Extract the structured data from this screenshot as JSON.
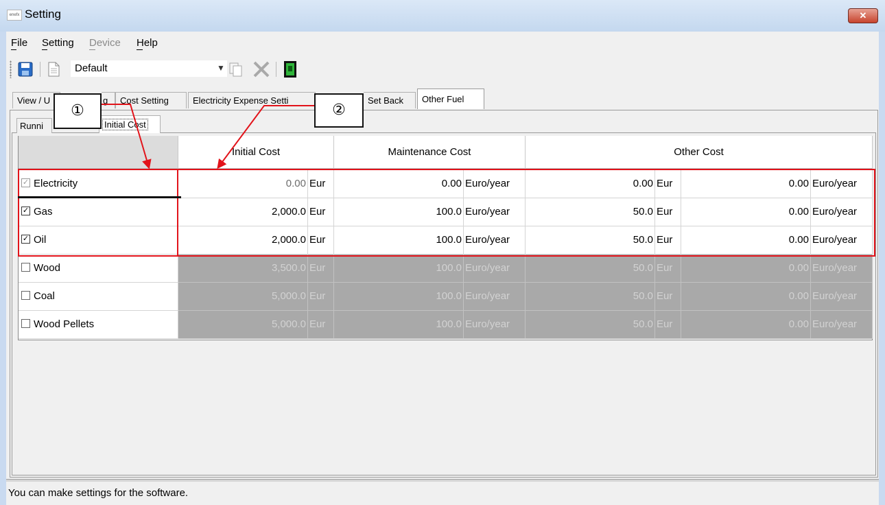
{
  "window": {
    "title": "Setting",
    "app_icon_text": "enefx",
    "close_label": "✕"
  },
  "menu": {
    "items": [
      "File",
      "Setting",
      "Device",
      "Help"
    ]
  },
  "toolbar": {
    "profile_value": "Default"
  },
  "main_tabs": [
    "View / U",
    "g",
    "Cost Setting",
    "Electricity Expense Setti",
    "Set Back",
    "Other Fuel"
  ],
  "sub_tabs": [
    "Runni",
    "Initial Cost"
  ],
  "grid": {
    "headers": [
      "Initial Cost",
      "Maintenance Cost",
      "Other Cost"
    ],
    "rows": [
      {
        "name": "Electricity",
        "checked": true,
        "enabled_checkbox": false,
        "row_disabled": false,
        "v1": "0.00",
        "u1": "Eur",
        "v2": "0.00",
        "u2": "Euro/year",
        "v3": "0.00",
        "u3": "Eur",
        "v4": "0.00",
        "u4": "Euro/year"
      },
      {
        "name": "Gas",
        "checked": true,
        "enabled_checkbox": true,
        "row_disabled": false,
        "v1": "2,000.0",
        "u1": "Eur",
        "v2": "100.0",
        "u2": "Euro/year",
        "v3": "50.0",
        "u3": "Eur",
        "v4": "0.00",
        "u4": "Euro/year"
      },
      {
        "name": "Oil",
        "checked": true,
        "enabled_checkbox": true,
        "row_disabled": false,
        "v1": "2,000.0",
        "u1": "Eur",
        "v2": "100.0",
        "u2": "Euro/year",
        "v3": "50.0",
        "u3": "Eur",
        "v4": "0.00",
        "u4": "Euro/year"
      },
      {
        "name": "Wood",
        "checked": false,
        "enabled_checkbox": true,
        "row_disabled": true,
        "v1": "3,500.0",
        "u1": "Eur",
        "v2": "100.0",
        "u2": "Euro/year",
        "v3": "50.0",
        "u3": "Eur",
        "v4": "0.00",
        "u4": "Euro/year"
      },
      {
        "name": "Coal",
        "checked": false,
        "enabled_checkbox": true,
        "row_disabled": true,
        "v1": "5,000.0",
        "u1": "Eur",
        "v2": "100.0",
        "u2": "Euro/year",
        "v3": "50.0",
        "u3": "Eur",
        "v4": "0.00",
        "u4": "Euro/year"
      },
      {
        "name": "Wood Pellets",
        "checked": false,
        "enabled_checkbox": true,
        "row_disabled": true,
        "v1": "5,000.0",
        "u1": "Eur",
        "v2": "100.0",
        "u2": "Euro/year",
        "v3": "50.0",
        "u3": "Eur",
        "v4": "0.00",
        "u4": "Euro/year"
      }
    ]
  },
  "annotations": {
    "callout1": "①",
    "callout2": "②",
    "color": "#e2131a"
  },
  "status": {
    "text": "You can make settings for the software."
  }
}
